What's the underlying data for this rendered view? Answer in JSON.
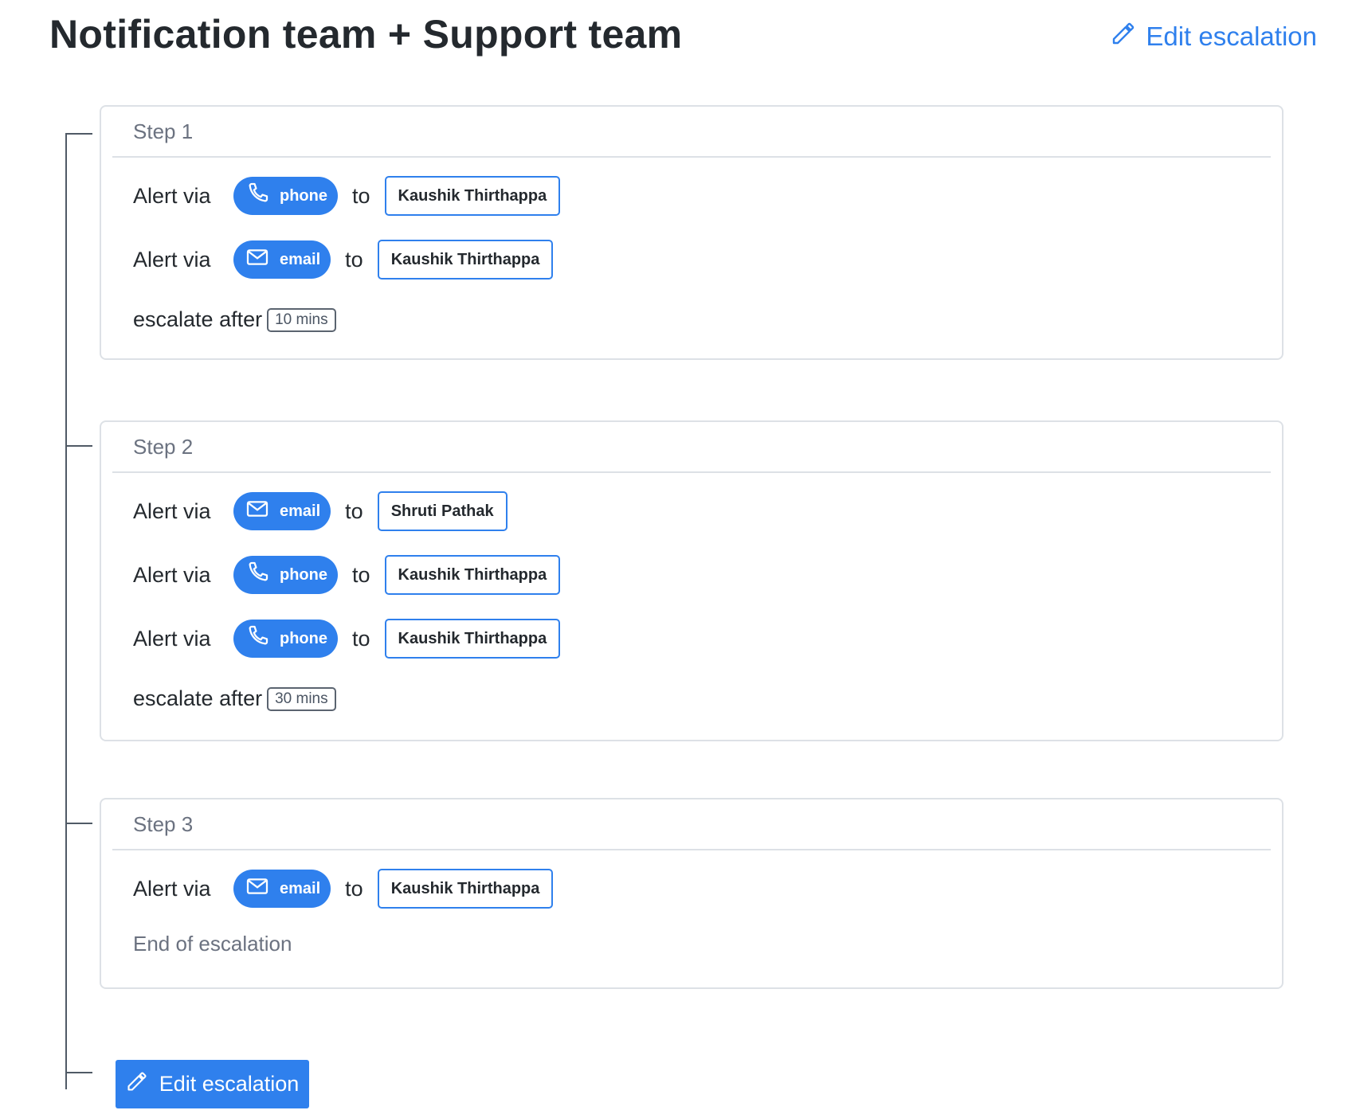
{
  "page": {
    "title": "Notification team + Support team",
    "edit_label": "Edit escalation",
    "edit_button_label": "Edit escalation"
  },
  "colors": {
    "accent": "#2f80ed",
    "border": "#dde1e6",
    "tree_line": "#505a66"
  },
  "icons": {
    "edit": "pencil-icon",
    "phone": "phone-icon",
    "email": "envelope-icon"
  },
  "steps": [
    {
      "label": "Step 1",
      "rules": [
        {
          "prefix": "Alert via",
          "channel": "phone",
          "to": "to",
          "person": "Kaushik Thirthappa"
        },
        {
          "prefix": "Alert via",
          "channel": "email",
          "to": "to",
          "person": "Kaushik Thirthappa"
        }
      ],
      "escalate_label": "escalate after",
      "escalate_value": "10 mins"
    },
    {
      "label": "Step 2",
      "rules": [
        {
          "prefix": "Alert via",
          "channel": "email",
          "to": "to",
          "person": "Shruti Pathak"
        },
        {
          "prefix": "Alert via",
          "channel": "phone",
          "to": "to",
          "person": "Kaushik Thirthappa"
        },
        {
          "prefix": "Alert via",
          "channel": "phone",
          "to": "to",
          "person": "Kaushik Thirthappa"
        }
      ],
      "escalate_label": "escalate after",
      "escalate_value": "30 mins"
    },
    {
      "label": "Step 3",
      "rules": [
        {
          "prefix": "Alert via",
          "channel": "email",
          "to": "to",
          "person": "Kaushik Thirthappa"
        }
      ],
      "end_label": "End of escalation"
    }
  ]
}
